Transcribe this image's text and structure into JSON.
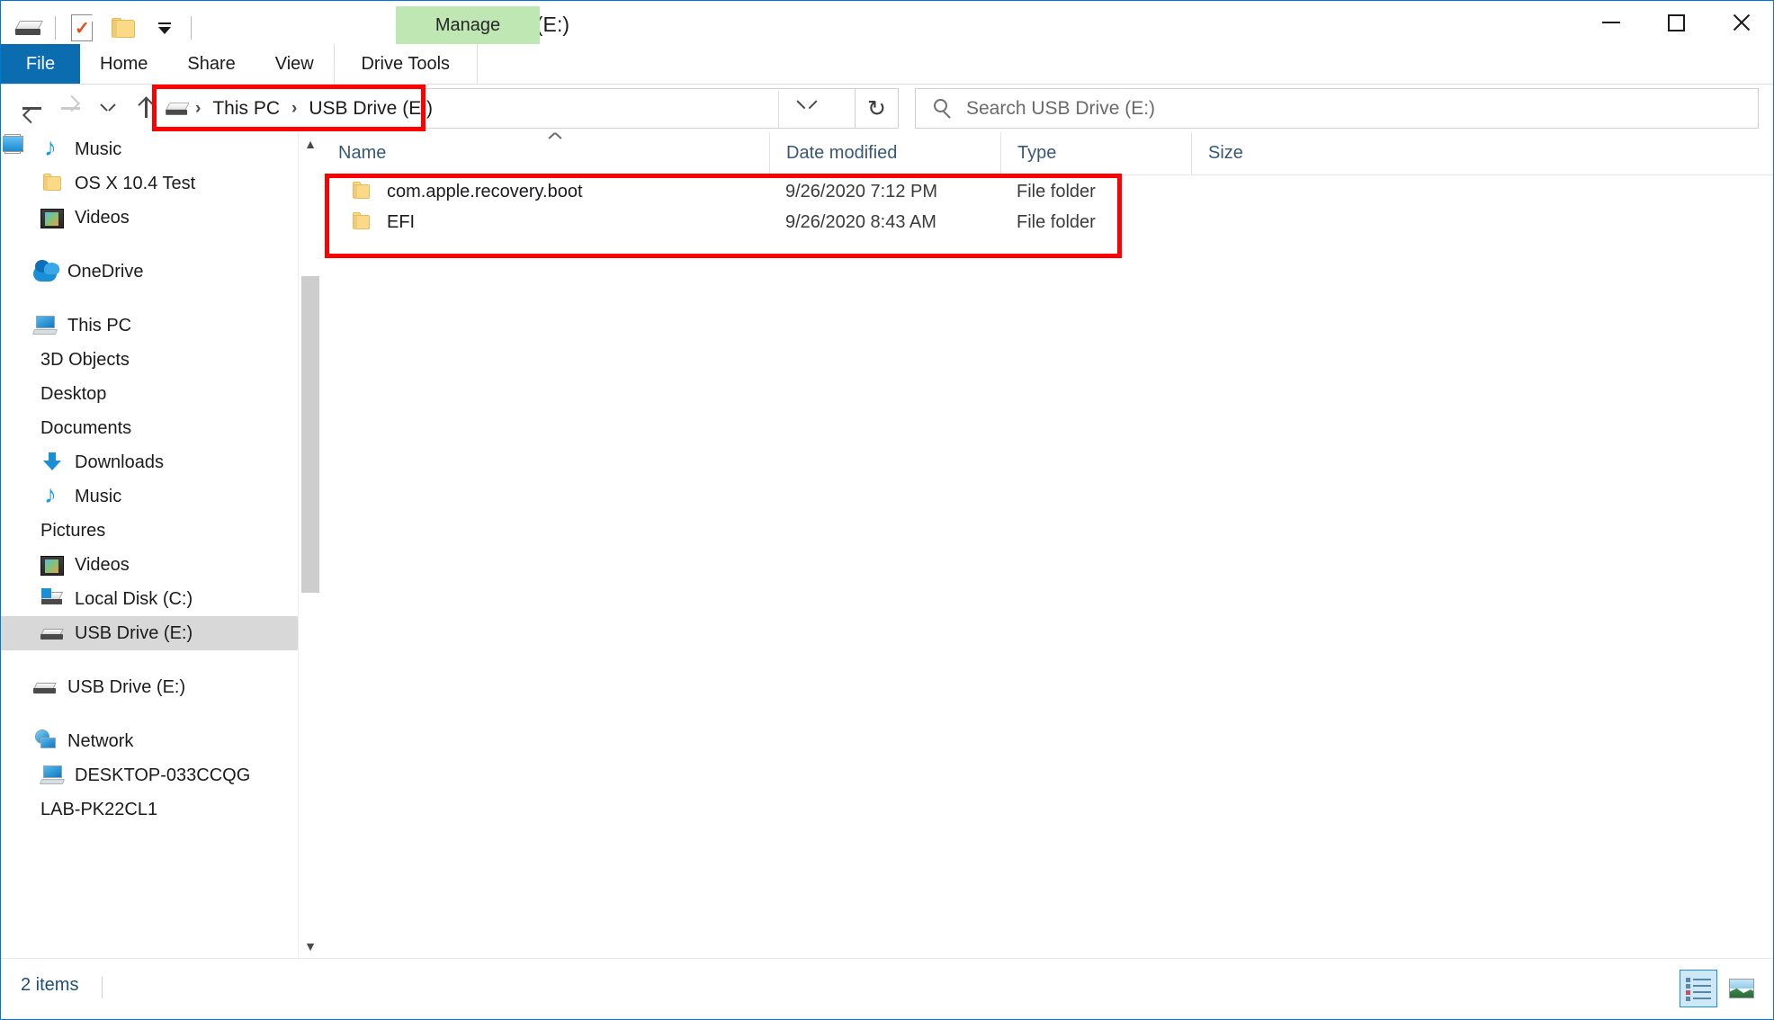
{
  "window": {
    "title": "USB Drive (E:)",
    "accent_color": "#0b6cb0",
    "highlight_color": "#ff0000",
    "contextual_tab_color": "#bfe7b4"
  },
  "quick_access_toolbar": {
    "drive_icon": "usb-drive-icon",
    "properties_icon": "properties-document-icon",
    "new_folder_icon": "new-folder-icon",
    "customize_icon": "customize-quick-access-chevron-icon"
  },
  "window_controls": {
    "minimize": "minimize-icon",
    "maximize": "maximize-icon",
    "close": "close-icon"
  },
  "ribbon": {
    "contextual_group_label": "Manage",
    "tabs": [
      {
        "label": "File",
        "active": true,
        "kind": "file"
      },
      {
        "label": "Home",
        "active": false,
        "kind": "normal"
      },
      {
        "label": "Share",
        "active": false,
        "kind": "normal"
      },
      {
        "label": "View",
        "active": false,
        "kind": "normal"
      },
      {
        "label": "Drive Tools",
        "active": false,
        "kind": "contextual"
      }
    ],
    "collapse_icon": "chevron-down-icon",
    "help_label": "?"
  },
  "navigation": {
    "back_icon": "back-arrow-icon",
    "forward_icon": "forward-arrow-icon",
    "recent_icon": "recent-locations-chevron-icon",
    "up_icon": "up-arrow-icon",
    "refresh_icon": "↻",
    "address_dropdown_icon": "address-dropdown-chevron-icon",
    "breadcrumbs": [
      {
        "label": "This PC"
      },
      {
        "label": "USB Drive (E:)"
      }
    ],
    "breadcrumb_separator": "›",
    "drive_icon": "usb-drive-icon"
  },
  "search": {
    "placeholder": "Search USB Drive (E:)",
    "value": "",
    "icon": "search-icon"
  },
  "sidebar": {
    "items": [
      {
        "label": "Music",
        "icon": "music-icon",
        "level": 1,
        "selected": false,
        "spacer_before": false
      },
      {
        "label": "OS X 10.4 Test",
        "icon": "folder-icon",
        "level": 1,
        "selected": false,
        "spacer_before": false
      },
      {
        "label": "Videos",
        "icon": "videos-icon",
        "level": 1,
        "selected": false,
        "spacer_before": false
      },
      {
        "label": "OneDrive",
        "icon": "onedrive-icon",
        "level": 0,
        "selected": false,
        "spacer_before": true
      },
      {
        "label": "This PC",
        "icon": "this-pc-icon",
        "level": 0,
        "selected": false,
        "spacer_before": true
      },
      {
        "label": "3D Objects",
        "icon": "3d-objects-icon",
        "level": 1,
        "selected": false,
        "spacer_before": false
      },
      {
        "label": "Desktop",
        "icon": "desktop-icon",
        "level": 1,
        "selected": false,
        "spacer_before": false
      },
      {
        "label": "Documents",
        "icon": "documents-icon",
        "level": 1,
        "selected": false,
        "spacer_before": false
      },
      {
        "label": "Downloads",
        "icon": "downloads-icon",
        "level": 1,
        "selected": false,
        "spacer_before": false
      },
      {
        "label": "Music",
        "icon": "music-icon",
        "level": 1,
        "selected": false,
        "spacer_before": false
      },
      {
        "label": "Pictures",
        "icon": "pictures-icon",
        "level": 1,
        "selected": false,
        "spacer_before": false
      },
      {
        "label": "Videos",
        "icon": "videos-icon",
        "level": 1,
        "selected": false,
        "spacer_before": false
      },
      {
        "label": "Local Disk (C:)",
        "icon": "local-disk-icon",
        "level": 1,
        "selected": false,
        "spacer_before": false
      },
      {
        "label": "USB Drive (E:)",
        "icon": "usb-drive-icon",
        "level": 1,
        "selected": true,
        "spacer_before": false
      },
      {
        "label": "USB Drive (E:)",
        "icon": "usb-drive-icon",
        "level": 0,
        "selected": false,
        "spacer_before": true
      },
      {
        "label": "Network",
        "icon": "network-icon",
        "level": 0,
        "selected": false,
        "spacer_before": true
      },
      {
        "label": "DESKTOP-033CCQG",
        "icon": "computer-icon",
        "level": 1,
        "selected": false,
        "spacer_before": false
      },
      {
        "label": "LAB-PK22CL1",
        "icon": "folder-blue-icon",
        "level": 1,
        "selected": false,
        "spacer_before": false
      }
    ],
    "scroll_up_icon": "scroll-up-arrow-icon",
    "scroll_down_icon": "scroll-down-arrow-icon"
  },
  "file_list": {
    "columns": [
      {
        "label": "Name",
        "sorted": true,
        "sort_direction": "asc"
      },
      {
        "label": "Date modified",
        "sorted": false,
        "sort_direction": ""
      },
      {
        "label": "Type",
        "sorted": false,
        "sort_direction": ""
      },
      {
        "label": "Size",
        "sorted": false,
        "sort_direction": ""
      }
    ],
    "rows": [
      {
        "name": "com.apple.recovery.boot",
        "date_modified": "9/26/2020 7:12 PM",
        "type": "File folder",
        "size": "",
        "icon": "folder-icon"
      },
      {
        "name": "EFI",
        "date_modified": "9/26/2020 8:43 AM",
        "type": "File folder",
        "size": "",
        "icon": "folder-icon"
      }
    ]
  },
  "status_bar": {
    "item_count": "2 items",
    "view_details_icon": "details-view-icon",
    "view_thumbnails_icon": "large-icons-view-icon",
    "active_view": "details"
  },
  "annotations": [
    {
      "name": "address-bar-highlight",
      "color": "#ff0000"
    },
    {
      "name": "file-rows-highlight",
      "color": "#ff0000"
    }
  ]
}
